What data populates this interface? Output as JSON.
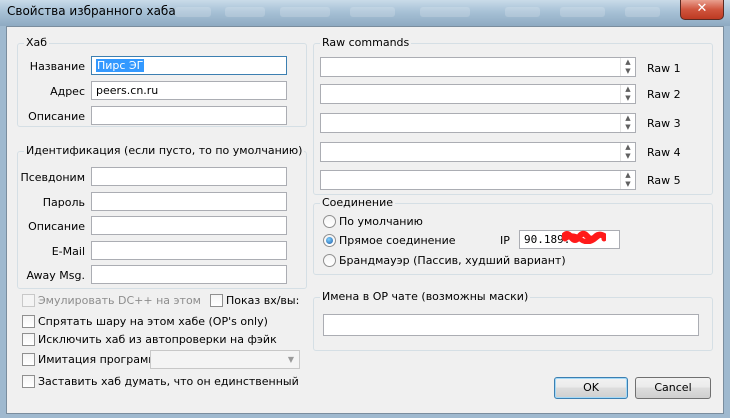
{
  "window": {
    "title": "Свойства избранного хаба",
    "close_glyph": "✕"
  },
  "hub": {
    "group_label": "Хаб",
    "name_label": "Название",
    "name_value": "Пирс ЭГ",
    "address_label": "Адрес",
    "address_value": "peers.cn.ru",
    "description_label": "Описание",
    "description_value": ""
  },
  "identity": {
    "group_label": "Идентификация (если пусто, то по умолчанию)",
    "nick_label": "Псевдоним",
    "password_label": "Пароль",
    "description_label": "Описание",
    "email_label": "E-Mail",
    "away_label": "Away Msg."
  },
  "options": {
    "emulate_dc": "Эмулировать DC++ на этом хабе",
    "show_joins": "Показ вх/вы:",
    "hide_share": "Спрятать шару на этом хабе (OP's only)",
    "exclude_check": "Исключить хаб из автопроверки на фэйк",
    "imitate_program": "Имитация программы",
    "force_single": "Заставить хаб думать, что он единственный"
  },
  "raw": {
    "group_label": "Raw commands",
    "labels": [
      "Raw 1",
      "Raw 2",
      "Raw 3",
      "Raw 4",
      "Raw 5"
    ]
  },
  "connection": {
    "group_label": "Соединение",
    "default": "По умолчанию",
    "direct": "Прямое соединение",
    "firewall": "Брандмауэр (Пассив, худший вариант)",
    "ip_label": "IP",
    "ip_value": "90.189."
  },
  "op_chat": {
    "group_label": "Имена в OP чате (возможны маски)",
    "value": ""
  },
  "buttons": {
    "ok": "OK",
    "cancel": "Cancel"
  },
  "colors": {
    "titlebar": "#a7c1d6",
    "accent": "#3c7fb1",
    "selection": "#3399ff",
    "redaction": "#ff1a1a"
  }
}
